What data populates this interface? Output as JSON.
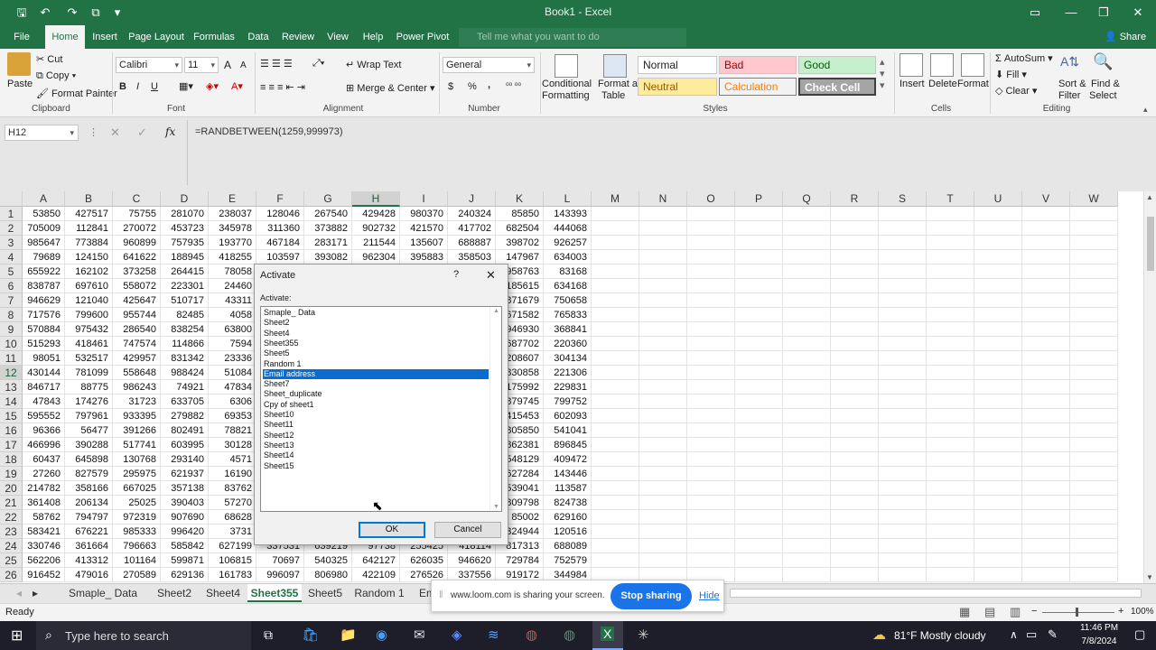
{
  "window": {
    "title": "Book1  -  Excel"
  },
  "ribbon_tabs": [
    "File",
    "Home",
    "Insert",
    "Page Layout",
    "Formulas",
    "Data",
    "Review",
    "View",
    "Help",
    "Power Pivot"
  ],
  "tell_me": "Tell me what you want to do",
  "share": "Share",
  "clipboard": {
    "cut": "Cut",
    "copy": "Copy",
    "paste": "Paste",
    "format_painter": "Format Painter",
    "label": "Clipboard"
  },
  "font": {
    "name": "Calibri",
    "size": "11",
    "label": "Font",
    "bold": "B",
    "italic": "I",
    "underline": "U",
    "grow": "A",
    "shrink": "A"
  },
  "alignment": {
    "wrap": "Wrap Text",
    "merge": "Merge & Center",
    "label": "Alignment"
  },
  "number": {
    "format": "General",
    "currency": "$",
    "percent": "%",
    "comma": ",",
    "label": "Number"
  },
  "styles": {
    "conditional": "Conditional",
    "conditional2": "Formatting",
    "format_table": "Format as",
    "format_table2": "Table",
    "normal": "Normal",
    "bad": "Bad",
    "good": "Good",
    "neutral": "Neutral",
    "calculation": "Calculation",
    "check_cell": "Check Cell",
    "label": "Styles"
  },
  "cells": {
    "insert": "Insert",
    "delete": "Delete",
    "format": "Format",
    "label": "Cells"
  },
  "editing": {
    "autosum": "AutoSum",
    "fill": "Fill",
    "clear": "Clear",
    "sort": "Sort &",
    "sort2": "Filter",
    "find": "Find &",
    "find2": "Select",
    "label": "Editing"
  },
  "formula_bar": {
    "name_box": "H12",
    "formula": "=RANDBETWEEN(1259,999973)",
    "fx": "fx",
    "cancel": "✕",
    "enter": "✓"
  },
  "columns": [
    "A",
    "B",
    "C",
    "D",
    "E",
    "F",
    "G",
    "H",
    "I",
    "J",
    "K",
    "L",
    "M",
    "N",
    "O",
    "P",
    "Q",
    "R",
    "S",
    "T",
    "U",
    "V",
    "W"
  ],
  "selected_column": "H",
  "selected_row": "12",
  "rows": [
    {
      "n": "1",
      "v": [
        "53850",
        "427517",
        "75755",
        "281070",
        "238037",
        "128046",
        "267540",
        "429428",
        "980370",
        "240324",
        "85850",
        "143393"
      ]
    },
    {
      "n": "2",
      "v": [
        "705009",
        "112841",
        "270072",
        "453723",
        "345978",
        "311360",
        "373882",
        "902732",
        "421570",
        "417702",
        "682504",
        "444068"
      ]
    },
    {
      "n": "3",
      "v": [
        "985647",
        "773884",
        "960899",
        "757935",
        "193770",
        "467184",
        "283171",
        "211544",
        "135607",
        "688887",
        "398702",
        "926257"
      ]
    },
    {
      "n": "4",
      "v": [
        "79689",
        "124150",
        "641622",
        "188945",
        "418255",
        "103597",
        "393082",
        "962304",
        "395883",
        "358503",
        "147967",
        "634003"
      ]
    },
    {
      "n": "5",
      "v": [
        "655922",
        "162102",
        "373258",
        "264415",
        "78058",
        "",
        "",
        "",
        "",
        "",
        "958763",
        "83168"
      ]
    },
    {
      "n": "6",
      "v": [
        "838787",
        "697610",
        "558072",
        "223301",
        "24460",
        "",
        "",
        "",
        "",
        "",
        "185615",
        "634168"
      ]
    },
    {
      "n": "7",
      "v": [
        "946629",
        "121040",
        "425647",
        "510717",
        "43311",
        "",
        "",
        "",
        "",
        "",
        "871679",
        "750658"
      ]
    },
    {
      "n": "8",
      "v": [
        "717576",
        "799600",
        "955744",
        "82485",
        "4058",
        "",
        "",
        "",
        "",
        "",
        "671582",
        "765833"
      ]
    },
    {
      "n": "9",
      "v": [
        "570884",
        "975432",
        "286540",
        "838254",
        "63800",
        "",
        "",
        "",
        "",
        "",
        "946930",
        "368841"
      ]
    },
    {
      "n": "10",
      "v": [
        "515293",
        "418461",
        "747574",
        "114866",
        "7594",
        "",
        "",
        "",
        "",
        "",
        "687702",
        "220360"
      ]
    },
    {
      "n": "11",
      "v": [
        "98051",
        "532517",
        "429957",
        "831342",
        "23336",
        "",
        "",
        "",
        "",
        "",
        "208607",
        "304134"
      ]
    },
    {
      "n": "12",
      "v": [
        "430144",
        "781099",
        "558648",
        "988424",
        "51084",
        "",
        "",
        "",
        "",
        "",
        "830858",
        "221306"
      ]
    },
    {
      "n": "13",
      "v": [
        "846717",
        "88775",
        "986243",
        "74921",
        "47834",
        "",
        "",
        "",
        "",
        "",
        "175992",
        "229831"
      ]
    },
    {
      "n": "14",
      "v": [
        "47843",
        "174276",
        "31723",
        "633705",
        "6306",
        "",
        "",
        "",
        "",
        "",
        "879745",
        "799752"
      ]
    },
    {
      "n": "15",
      "v": [
        "595552",
        "797961",
        "933395",
        "279882",
        "69353",
        "",
        "",
        "",
        "",
        "",
        "415453",
        "602093"
      ]
    },
    {
      "n": "16",
      "v": [
        "96366",
        "56477",
        "391266",
        "802491",
        "78821",
        "",
        "",
        "",
        "",
        "",
        "805850",
        "541041"
      ]
    },
    {
      "n": "17",
      "v": [
        "466996",
        "390288",
        "517741",
        "603995",
        "30128",
        "",
        "",
        "",
        "",
        "",
        "862381",
        "896845"
      ]
    },
    {
      "n": "18",
      "v": [
        "60437",
        "645898",
        "130768",
        "293140",
        "4571",
        "",
        "",
        "",
        "",
        "",
        "548129",
        "409472"
      ]
    },
    {
      "n": "19",
      "v": [
        "27260",
        "827579",
        "295975",
        "621937",
        "16190",
        "",
        "",
        "",
        "",
        "",
        "627284",
        "143446"
      ]
    },
    {
      "n": "20",
      "v": [
        "214782",
        "358166",
        "667025",
        "357138",
        "83762",
        "",
        "",
        "",
        "",
        "",
        "539041",
        "113587"
      ]
    },
    {
      "n": "21",
      "v": [
        "361408",
        "206134",
        "25025",
        "390403",
        "57270",
        "",
        "",
        "",
        "",
        "",
        "809798",
        "824738"
      ]
    },
    {
      "n": "22",
      "v": [
        "58762",
        "794797",
        "972319",
        "907690",
        "68628",
        "",
        "",
        "",
        "",
        "",
        "85002",
        "629160"
      ]
    },
    {
      "n": "23",
      "v": [
        "583421",
        "676221",
        "985333",
        "996420",
        "3731",
        "",
        "",
        "",
        "",
        "",
        "324944",
        "120516"
      ]
    },
    {
      "n": "24",
      "v": [
        "330746",
        "361664",
        "796663",
        "585842",
        "627199",
        "337531",
        "639219",
        "97738",
        "255425",
        "418114",
        "817313",
        "688089"
      ]
    },
    {
      "n": "25",
      "v": [
        "562206",
        "413312",
        "101164",
        "599871",
        "106815",
        "70697",
        "540325",
        "642127",
        "626035",
        "946620",
        "729784",
        "752579"
      ]
    },
    {
      "n": "26",
      "v": [
        "916452",
        "479016",
        "270589",
        "629136",
        "161783",
        "996097",
        "806980",
        "422109",
        "276526",
        "337556",
        "919172",
        "344984"
      ]
    }
  ],
  "dialog": {
    "title": "Activate",
    "help": "?",
    "close": "✕",
    "label": "Activate:",
    "items": [
      "Smaple_ Data",
      "Sheet2",
      "Sheet4",
      "Sheet355",
      "Sheet5",
      "Random 1",
      "Email address",
      "Sheet7",
      "Sheet_duplicate",
      "Cpy of sheet1",
      "Sheet10",
      "Sheet11",
      "Sheet12",
      "Sheet13",
      "Sheet14",
      "Sheet15"
    ],
    "selected_index": 6,
    "ok": "OK",
    "cancel": "Cancel"
  },
  "sheet_tabs": [
    "Smaple_ Data",
    "Sheet2",
    "Sheet4",
    "Sheet355",
    "Sheet5",
    "Random 1",
    "Em"
  ],
  "active_sheet": "Sheet355",
  "loom": {
    "message": "www.loom.com is sharing your screen.",
    "stop": "Stop sharing",
    "hide": "Hide"
  },
  "status": {
    "ready": "Ready",
    "zoom": "100%"
  },
  "taskbar": {
    "search": "Type here to search",
    "weather": "81°F  Mostly cloudy",
    "time": "11:46 PM",
    "date": "7/8/2024"
  }
}
